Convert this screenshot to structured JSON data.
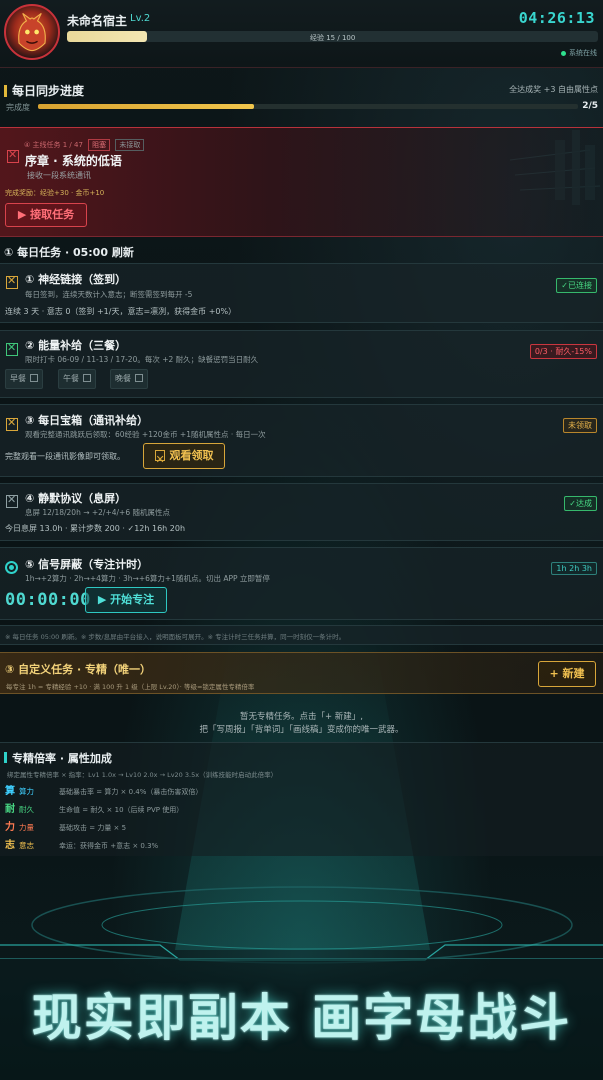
{
  "header": {
    "player_name": "未命名宿主",
    "level": "Lv.2",
    "timer": "04:26:13",
    "xp_text": "经验 15 / 100",
    "xp_progress": 0.15,
    "online_status": "系统在线"
  },
  "daily_sync": {
    "title": "每日同步进度",
    "reward": "全达成奖 +3 自由属性点",
    "label": "完成度",
    "count": "2/5",
    "progress": 0.4
  },
  "main_quest": {
    "tag_label": "④ 主线任务",
    "tag_count": "1 / 47",
    "tag_state": "阻塞",
    "tag_state2": "未接取",
    "title": "序章 · 系统的低语",
    "subtitle": "接收一段系统通讯",
    "reward": "完成奖励：经验+30 · 金币+10",
    "button": "▶ 接取任务"
  },
  "daily_head": "① 每日任务 · 05:00 刷新",
  "tasks": [
    {
      "title": "① 神经链接（签到）",
      "desc": "每日签到，连续天数计入意志；断签需签到每开 -5",
      "line": "连续 3 天 · 意志 0（签到 +1/天，意志=凛冽，获得金币 +0%）",
      "badge": "✓已连接"
    },
    {
      "title": "② 能量补给（三餐）",
      "desc": "限时打卡 06-09 / 11-13 / 17-20。每次 +2 耐久；缺餐惩罚当日耐久",
      "badge": "0/3 · 耐久-15%",
      "meals": [
        "早餐",
        "午餐",
        "晚餐"
      ]
    },
    {
      "title": "③ 每日宝箱（通讯补给）",
      "desc": "观看完整通讯跳跃后领取：60经验 +120金币 +1随机属性点 · 每日一次",
      "line": "完整观看一段通讯影像即可领取。",
      "badge": "未领取",
      "button": "观看领取"
    },
    {
      "title": "④ 静默协议（息屏）",
      "desc": "息屏 12/18/20h → +2/+4/+6 随机属性点",
      "line": "今日息屏 13.0h · 累计步数 200 · ✓12h 16h 20h",
      "badge": "✓达成"
    },
    {
      "title": "⑤ 信号屏蔽（专注计时）",
      "desc": "1h→+2算力 · 2h→+4算力 · 3h→+6算力+1随机点。切出 APP 立即暂停",
      "clock": "00:00:00",
      "button": "▶ 开始专注",
      "badge": "1h 2h 3h"
    }
  ],
  "note": "※ 每日任务 05:00 刷新。※ 步数/息屏由平台接入，说明面板可展开。※ 专注计时三任务并算，同一时刻仅一条计时。",
  "custom": {
    "title": "③ 自定义任务 · 专精（唯一）",
    "sub": "每专注 1h = 专精经验 +10 · 满 100 升 1 级（上限 Lv.20）· 等级=锁定属性专精倍率",
    "button": "+ 新建",
    "empty_line1": "暂无专精任务。点击「+ 新建」,",
    "empty_line2": "把「写周报」「背单词」「画线稿」变成你的唯一武器。"
  },
  "attributes": {
    "title": "专精倍率 · 属性加成",
    "formula": "绑定属性专精倍率 × 指率：Lv1 1.0x → Lv10 2.0x → Lv20 3.5x（训练技能时启动此倍率）",
    "rows": [
      {
        "key": "算",
        "name": "算力",
        "desc": "基础暴击率 = 算力 × 0.4%（暴击伤害双倍）",
        "color": "#3fd0ff"
      },
      {
        "key": "耐",
        "name": "耐久",
        "desc": "生命值 = 耐久 × 10（后续 PVP 使用）",
        "color": "#48d884"
      },
      {
        "key": "力",
        "name": "力量",
        "desc": "基础攻击 = 力量 × 5",
        "color": "#ff7b52"
      },
      {
        "key": "志",
        "name": "意志",
        "desc": "幸运：获得金币 +意志 × 0.3%",
        "color": "#f0c050"
      }
    ]
  },
  "banner": "现实即副本 画字母战斗"
}
